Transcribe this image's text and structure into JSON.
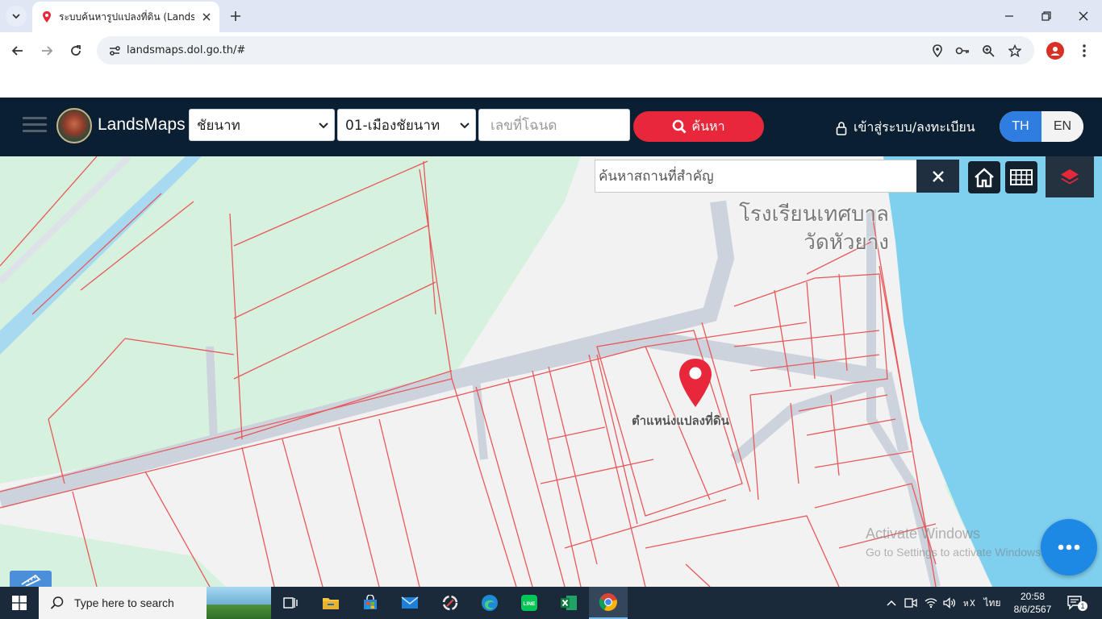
{
  "browser": {
    "tab_title": "ระบบค้นหารูปแปลงที่ดิน (LandsMap",
    "url": "landsmaps.dol.go.th/#"
  },
  "app": {
    "brand": "LandsMaps",
    "province": "ชัยนาท",
    "district": "01-เมืองชัยนาท",
    "deed_placeholder": "เลขที่โฉนด",
    "search_label": "ค้นหา",
    "login_label": "เข้าสู่ระบบ/ลงทะเบียน",
    "lang_th": "TH",
    "lang_en": "EN",
    "active_lang": "TH"
  },
  "map": {
    "place_search_placeholder": "ค้นหาสถานที่สำคัญ",
    "school_label_line1": "โรงเรียนเทศบาล",
    "school_label_line2": "วัดหัวยาง",
    "pin_label": "ตำแหน่งแปลงที่ดิน",
    "watermark_line1": "Activate Windows",
    "watermark_line2": "Go to Settings to activate Windows.",
    "colors": {
      "parcel_line": "#e8585a",
      "water": "#7fd0ef",
      "green_area": "#d6f1de",
      "road": "#ccd3dc",
      "pin": "#e8283a"
    }
  },
  "taskbar": {
    "search_placeholder": "Type here to search",
    "time": "20:58",
    "date": "8/6/2567",
    "language": "ไทย",
    "notification_count": "1",
    "pinned_apps": [
      "task-view-icon",
      "file-explorer-icon",
      "store-icon",
      "mail-icon",
      "snipping-tool-icon",
      "edge-icon",
      "line-icon",
      "excel-icon",
      "chrome-icon"
    ]
  }
}
